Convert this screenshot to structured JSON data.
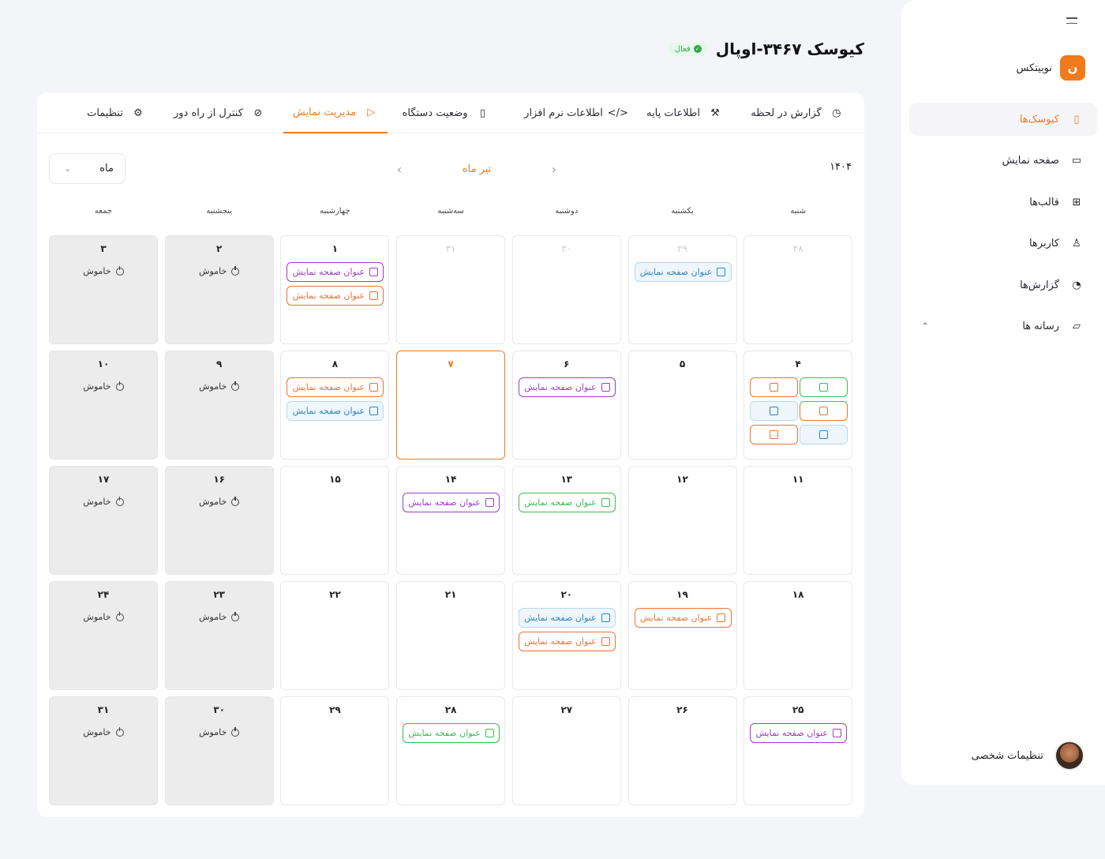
{
  "sidebar": {
    "brand_initial": "ن",
    "brand_name": "نوبیتکس",
    "items": [
      {
        "label": "کیوسک‌ها",
        "icon": "tablet-icon",
        "glyph": "▯"
      },
      {
        "label": "صفحه نمایش",
        "icon": "monitor-icon",
        "glyph": "▭"
      },
      {
        "label": "قالب‌ها",
        "icon": "grid-icon",
        "glyph": "⊞"
      },
      {
        "label": "کاربرها",
        "icon": "user-icon",
        "glyph": "♙"
      },
      {
        "label": "گزارش‌ها",
        "icon": "pie-chart-icon",
        "glyph": "◔"
      },
      {
        "label": "رسانه ها",
        "icon": "folder-icon",
        "glyph": "▱",
        "caret": "⌃"
      }
    ],
    "profile_label": "تنظیمات شخصی"
  },
  "header": {
    "title": "کیوسک ۳۴۶۷-اوپال",
    "status_badge": "فعال"
  },
  "tabs": [
    {
      "label": "گزارش در لحظه",
      "icon": "speedometer-icon",
      "glyph": "◷"
    },
    {
      "label": "اطلاعات پایه",
      "icon": "wrench-icon",
      "glyph": "⚒"
    },
    {
      "label": "اطلاعات نرم افزار",
      "icon": "code-icon",
      "glyph": "</>"
    },
    {
      "label": "وضعیت دستگاه",
      "icon": "tablet-icon",
      "glyph": "▯"
    },
    {
      "label": "مدیریت نمایش",
      "icon": "play-icon",
      "glyph": "▷"
    },
    {
      "label": "کنترل از راه دور",
      "icon": "link-icon",
      "glyph": "⊘"
    },
    {
      "label": "تنظیمات",
      "icon": "sliders-icon",
      "glyph": "⚙"
    }
  ],
  "calendar": {
    "year": "۱۴۰۴",
    "month": "تیر ماه",
    "view": "ماه",
    "weekdays": [
      "شنبه",
      "یکشنبه",
      "دوشنبه",
      "سه‌شنبه",
      "چهارشنبه",
      "پنجشنبه",
      "جمعه"
    ],
    "off_label": "خاموش",
    "event_label": "عنوان صفحه نمایش",
    "weeks": [
      [
        {
          "day": "۲۸",
          "prev": true
        },
        {
          "day": "۲۹",
          "prev": true,
          "events": [
            {
              "color": "blue"
            }
          ]
        },
        {
          "day": "۳۰",
          "prev": true
        },
        {
          "day": "۳۱",
          "prev": true
        },
        {
          "day": "۱",
          "events": [
            {
              "color": "purple"
            },
            {
              "color": "orange"
            }
          ]
        },
        {
          "day": "۲",
          "off": true
        },
        {
          "day": "۳",
          "off": true
        }
      ],
      [
        {
          "day": "۴",
          "mini": [
            {
              "color": "green"
            },
            {
              "color": "orange"
            },
            {
              "color": "orange"
            },
            {
              "color": "blue"
            },
            {
              "color": "blue"
            },
            {
              "color": "orange"
            }
          ]
        },
        {
          "day": "۵"
        },
        {
          "day": "۶",
          "events": [
            {
              "color": "purple"
            }
          ]
        },
        {
          "day": "۷",
          "today": true
        },
        {
          "day": "۸",
          "events": [
            {
              "color": "orange"
            },
            {
              "color": "blue"
            }
          ]
        },
        {
          "day": "۹",
          "off": true
        },
        {
          "day": "۱۰",
          "off": true
        }
      ],
      [
        {
          "day": "۱۱"
        },
        {
          "day": "۱۲"
        },
        {
          "day": "۱۳",
          "events": [
            {
              "color": "green"
            }
          ]
        },
        {
          "day": "۱۴",
          "events": [
            {
              "color": "purple"
            }
          ]
        },
        {
          "day": "۱۵"
        },
        {
          "day": "۱۶",
          "off": true
        },
        {
          "day": "۱۷",
          "off": true
        }
      ],
      [
        {
          "day": "۱۸"
        },
        {
          "day": "۱۹",
          "events": [
            {
              "color": "orange"
            }
          ]
        },
        {
          "day": "۲۰",
          "events": [
            {
              "color": "blue"
            },
            {
              "color": "orange"
            }
          ]
        },
        {
          "day": "۲۱"
        },
        {
          "day": "۲۲"
        },
        {
          "day": "۲۳",
          "off": true
        },
        {
          "day": "۲۴",
          "off": true
        }
      ],
      [
        {
          "day": "۲۵",
          "events": [
            {
              "color": "purple"
            }
          ]
        },
        {
          "day": "۲۶"
        },
        {
          "day": "۲۷"
        },
        {
          "day": "۲۸",
          "events": [
            {
              "color": "green"
            }
          ]
        },
        {
          "day": "۲۹"
        },
        {
          "day": "۳۰",
          "off": true
        },
        {
          "day": "۳۱",
          "off": true
        }
      ]
    ]
  },
  "colors": {
    "accent": "#f07a1c",
    "purple": "#9b3fc4",
    "blue": "#2d86c4",
    "green": "#3fba55",
    "orange": "#e9743a"
  }
}
